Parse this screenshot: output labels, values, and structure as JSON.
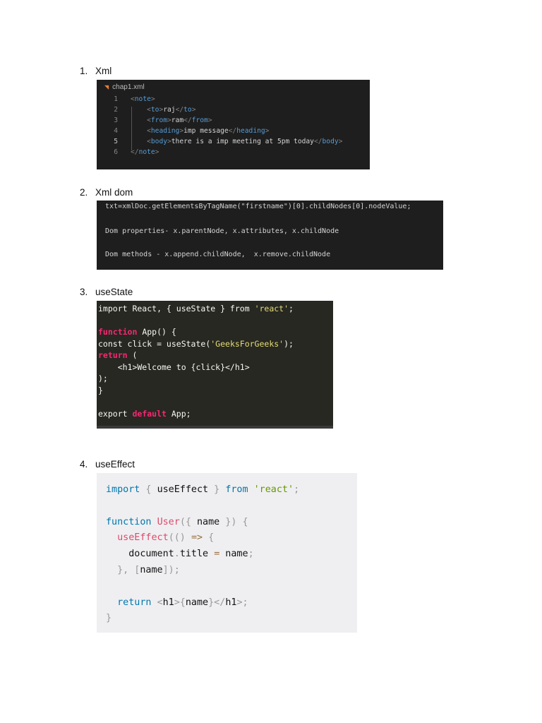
{
  "headings": [
    {
      "num": "1.",
      "label": "Xml"
    },
    {
      "num": "2.",
      "label": "Xml dom"
    },
    {
      "num": "3.",
      "label": "useState"
    },
    {
      "num": "4.",
      "label": "useEffect"
    }
  ],
  "xml_editor": {
    "tab_label": "chap1.xml",
    "tab_icon": "rss-file-icon",
    "line_numbers": [
      "1",
      "2",
      "3",
      "4",
      "5",
      "6"
    ]
  },
  "colors": {
    "xml_bg": "#1e1e1e",
    "monokai_bg": "#272822",
    "light_bg": "#efeff2"
  },
  "blocks": [
    {
      "lines": [
        [
          [
            "<",
            "br"
          ],
          [
            "note",
            "tag"
          ],
          [
            ">",
            "br"
          ]
        ],
        [
          [
            "    <",
            "br"
          ],
          [
            "to",
            "tag"
          ],
          [
            ">",
            "br"
          ],
          [
            "raj",
            "tx"
          ],
          [
            "</",
            "br"
          ],
          [
            "to",
            "tag"
          ],
          [
            ">",
            "br"
          ]
        ],
        [
          [
            "    <",
            "br"
          ],
          [
            "from",
            "tag"
          ],
          [
            ">",
            "br"
          ],
          [
            "ram",
            "tx"
          ],
          [
            "</",
            "br"
          ],
          [
            "from",
            "tag"
          ],
          [
            ">",
            "br"
          ]
        ],
        [
          [
            "    <",
            "br"
          ],
          [
            "heading",
            "tag"
          ],
          [
            ">",
            "br"
          ],
          [
            "imp message",
            "tx"
          ],
          [
            "</",
            "br"
          ],
          [
            "heading",
            "tag"
          ],
          [
            ">",
            "br"
          ]
        ],
        [
          [
            "    <",
            "br"
          ],
          [
            "body",
            "tag"
          ],
          [
            ">",
            "br"
          ],
          [
            "there is a imp meeting at 5pm today",
            "tx"
          ],
          [
            "</",
            "br"
          ],
          [
            "body",
            "tag"
          ],
          [
            ">",
            "br"
          ]
        ],
        [
          [
            "</",
            "br"
          ],
          [
            "note",
            "tag"
          ],
          [
            ">",
            "br"
          ]
        ]
      ]
    },
    {
      "lines": [
        [
          [
            "txt=xmlDoc.getElementsByTagName(\"firstname\")[0].childNodes[0].nodeValue;",
            "tx"
          ]
        ],
        [
          [
            "Dom properties- x.parentNode, x.attributes, x.childNode",
            "tx"
          ]
        ],
        [
          [
            "Dom methods - x.append.childNode,  x.remove.childNode",
            "tx"
          ]
        ]
      ]
    },
    {
      "lines": [
        [
          [
            "import React, { useState } from ",
            "w"
          ],
          [
            "'react'",
            "str"
          ],
          [
            ";",
            "w"
          ]
        ],
        [],
        [
          [
            "function",
            "kw"
          ],
          [
            " App() {",
            "w"
          ]
        ],
        [
          [
            "const click = useState(",
            "w"
          ],
          [
            "'GeeksForGeeks'",
            "str"
          ],
          [
            ");",
            "w"
          ]
        ],
        [
          [
            "return",
            "kw"
          ],
          [
            " (",
            "w"
          ]
        ],
        [
          [
            "    <h1>Welcome to {click}</h1>",
            "w"
          ]
        ],
        [
          [
            ");",
            "w"
          ]
        ],
        [
          [
            "}",
            "w"
          ]
        ],
        [],
        [
          [
            "export ",
            "w"
          ],
          [
            "default",
            "kw"
          ],
          [
            " App;",
            "w"
          ]
        ]
      ]
    },
    {
      "lines": [
        [
          [
            "import",
            "bl"
          ],
          [
            " { ",
            "p"
          ],
          [
            "useEffect",
            "k"
          ],
          [
            " } ",
            "p"
          ],
          [
            "from",
            "bl"
          ],
          [
            " ",
            "k"
          ],
          [
            "'react'",
            "gr"
          ],
          [
            ";",
            "p"
          ]
        ],
        [],
        [
          [
            "function",
            "bl"
          ],
          [
            " ",
            "k"
          ],
          [
            "User",
            "fn"
          ],
          [
            "({ ",
            "p"
          ],
          [
            "name",
            "k"
          ],
          [
            " }) {",
            "p"
          ]
        ],
        [
          [
            "  ",
            "k"
          ],
          [
            "useEffect",
            "fn"
          ],
          [
            "(() ",
            "p"
          ],
          [
            "=>",
            "op"
          ],
          [
            " {",
            "p"
          ]
        ],
        [
          [
            "    document",
            "k"
          ],
          [
            ".",
            "p"
          ],
          [
            "title ",
            "k"
          ],
          [
            "=",
            "op"
          ],
          [
            " name",
            "k"
          ],
          [
            ";",
            "p"
          ]
        ],
        [
          [
            "  }, [",
            "p"
          ],
          [
            "name",
            "k"
          ],
          [
            "]);",
            "p"
          ]
        ],
        [],
        [
          [
            "  ",
            "k"
          ],
          [
            "return",
            "bl"
          ],
          [
            " <",
            "p"
          ],
          [
            "h1",
            "k"
          ],
          [
            ">{",
            "p"
          ],
          [
            "name",
            "k"
          ],
          [
            "}</",
            "p"
          ],
          [
            "h1",
            "k"
          ],
          [
            ">;",
            "p"
          ]
        ],
        [
          [
            "}",
            "p"
          ]
        ]
      ]
    }
  ]
}
